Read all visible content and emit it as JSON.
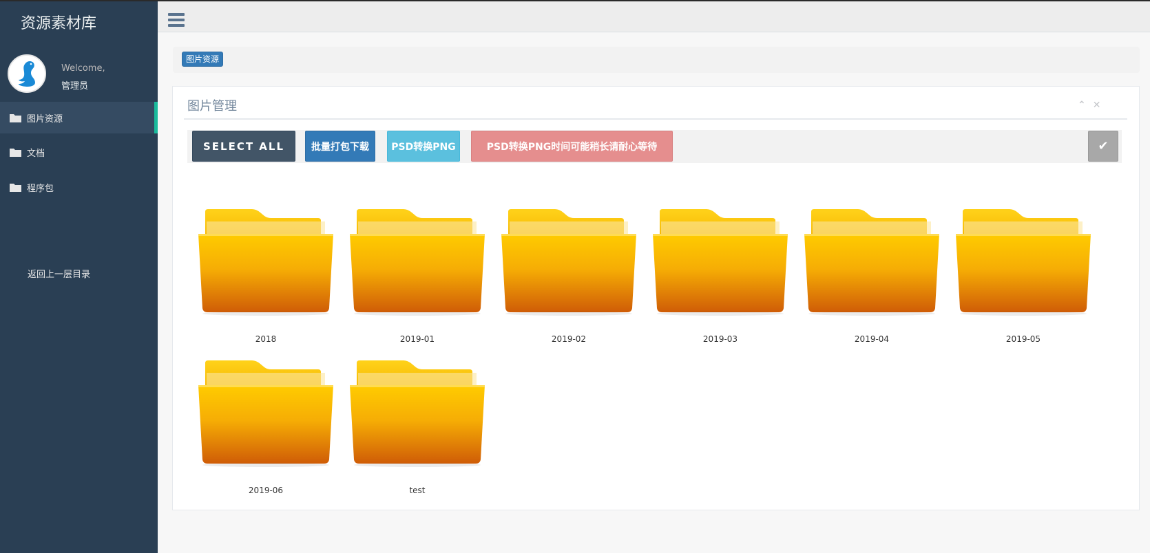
{
  "app": {
    "title": "资源素材库"
  },
  "profile": {
    "welcome": "Welcome,",
    "name": "管理员"
  },
  "sidebar": {
    "items": [
      {
        "label": "图片资源",
        "icon": "folder-icon",
        "active": true
      },
      {
        "label": "文档",
        "icon": "folder-icon",
        "active": false
      },
      {
        "label": "程序包",
        "icon": "folder-icon",
        "active": false
      }
    ],
    "back_label": "返回上一层目录"
  },
  "breadcrumb": {
    "current": "图片资源"
  },
  "panel": {
    "title": "图片管理",
    "collapse_icon": "chevron-up-icon",
    "close_icon": "close-icon"
  },
  "toolbar": {
    "select_all": "SELECT ALL",
    "batch_download": "批量打包下载",
    "psd_convert": "PSD转换PNG",
    "psd_warning": "PSD转换PNG时间可能稍长请耐心等待",
    "confirm_icon": "check-icon"
  },
  "folders": [
    {
      "name": "2018"
    },
    {
      "name": "2019-01"
    },
    {
      "name": "2019-02"
    },
    {
      "name": "2019-03"
    },
    {
      "name": "2019-04"
    },
    {
      "name": "2019-05"
    },
    {
      "name": "2019-06"
    },
    {
      "name": "test"
    }
  ],
  "colors": {
    "sidebar_bg": "#2a3f54",
    "active_accent": "#1ABB9C",
    "primary": "#337ab7",
    "info": "#5bc0de",
    "danger_light": "#e58e8e",
    "dark_button": "#425567"
  }
}
